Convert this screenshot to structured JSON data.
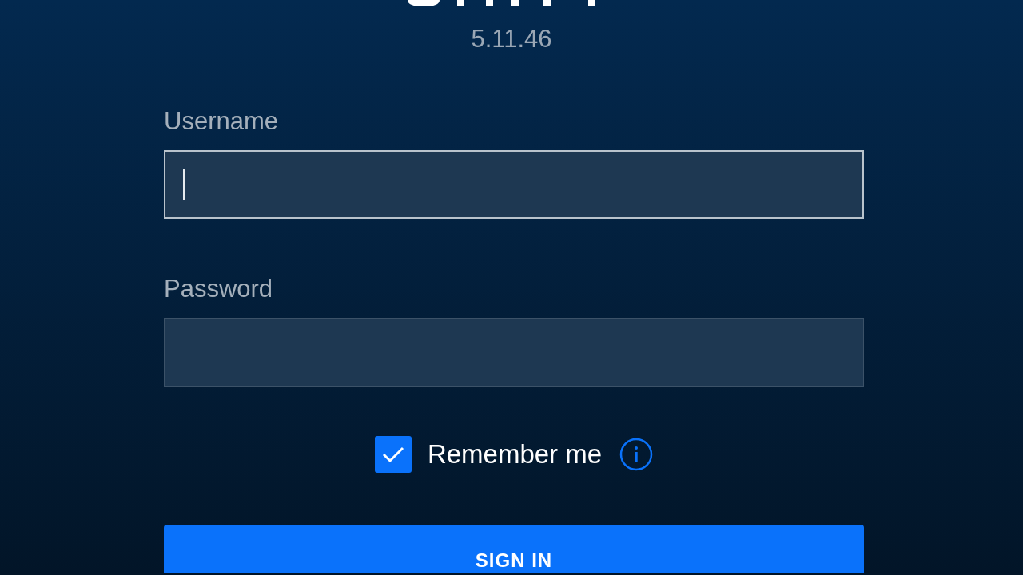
{
  "version": "5.11.46",
  "fields": [
    {
      "label": "Username",
      "focused": true
    },
    {
      "label": "Password",
      "focused": false
    }
  ],
  "remember": {
    "label": "Remember me",
    "checked": true
  },
  "sign_in": {
    "label": "SIGN IN"
  }
}
